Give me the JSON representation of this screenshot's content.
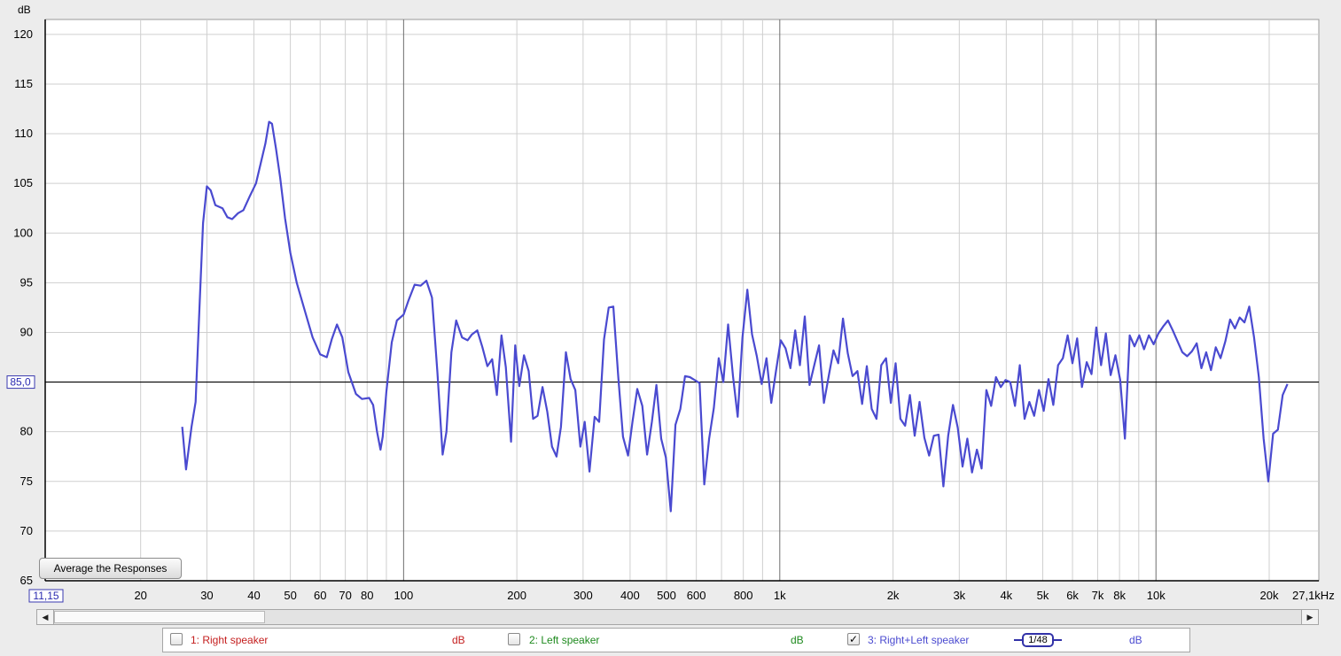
{
  "chart_data": {
    "type": "line",
    "x_scale": "log",
    "y_unit": "dB",
    "x_unit": "kHz",
    "xlim": [
      11.15,
      27100
    ],
    "ylim": [
      65,
      121.5
    ],
    "grid": true,
    "reference_line": 85.0,
    "reference_label": "85,0",
    "x_start_label": "11,15",
    "y_ticks": [
      {
        "value": 120,
        "label": "120"
      },
      {
        "value": 115,
        "label": "115"
      },
      {
        "value": 110,
        "label": "110"
      },
      {
        "value": 105,
        "label": "105"
      },
      {
        "value": 100,
        "label": "100"
      },
      {
        "value": 95,
        "label": "95"
      },
      {
        "value": 90,
        "label": "90"
      },
      {
        "value": 80,
        "label": "80"
      },
      {
        "value": 75,
        "label": "75"
      },
      {
        "value": 70,
        "label": "70"
      },
      {
        "value": 65,
        "label": "65"
      }
    ],
    "x_ticks": [
      {
        "value": 20,
        "label": "20"
      },
      {
        "value": 30,
        "label": "30"
      },
      {
        "value": 40,
        "label": "40"
      },
      {
        "value": 50,
        "label": "50"
      },
      {
        "value": 60,
        "label": "60"
      },
      {
        "value": 70,
        "label": "70"
      },
      {
        "value": 80,
        "label": "80"
      },
      {
        "value": 100,
        "label": "100"
      },
      {
        "value": 200,
        "label": "200"
      },
      {
        "value": 300,
        "label": "300"
      },
      {
        "value": 400,
        "label": "400"
      },
      {
        "value": 500,
        "label": "500"
      },
      {
        "value": 600,
        "label": "600"
      },
      {
        "value": 800,
        "label": "800"
      },
      {
        "value": 1000,
        "label": "1k"
      },
      {
        "value": 2000,
        "label": "2k"
      },
      {
        "value": 3000,
        "label": "3k"
      },
      {
        "value": 4000,
        "label": "4k"
      },
      {
        "value": 5000,
        "label": "5k"
      },
      {
        "value": 6000,
        "label": "6k"
      },
      {
        "value": 7000,
        "label": "7k"
      },
      {
        "value": 8000,
        "label": "8k"
      },
      {
        "value": 10000,
        "label": "10k"
      },
      {
        "value": 20000,
        "label": "20k"
      },
      {
        "value": 27100,
        "label": "27,1kHz"
      }
    ],
    "major_grid_x": [
      100,
      1000,
      10000
    ],
    "minor_grid_x": [
      20,
      30,
      40,
      50,
      60,
      70,
      80,
      90,
      200,
      300,
      400,
      500,
      600,
      700,
      800,
      900,
      2000,
      3000,
      4000,
      5000,
      6000,
      7000,
      8000,
      9000,
      20000
    ],
    "series": [
      {
        "name": "3: Right+Left speaker",
        "color": "#4a4ad0",
        "points": [
          [
            25.8,
            80.5
          ],
          [
            26.4,
            76.2
          ],
          [
            27.3,
            80.5
          ],
          [
            28.0,
            83.0
          ],
          [
            28.7,
            93.0
          ],
          [
            29.3,
            101.0
          ],
          [
            30.0,
            104.7
          ],
          [
            30.7,
            104.3
          ],
          [
            31.6,
            102.8
          ],
          [
            33.0,
            102.5
          ],
          [
            34.0,
            101.6
          ],
          [
            35.0,
            101.4
          ],
          [
            36.3,
            102.0
          ],
          [
            37.5,
            102.3
          ],
          [
            39.0,
            103.7
          ],
          [
            40.5,
            105.0
          ],
          [
            41.7,
            107.0
          ],
          [
            42.9,
            109.0
          ],
          [
            43.9,
            111.2
          ],
          [
            44.7,
            111.0
          ],
          [
            45.8,
            108.5
          ],
          [
            47.0,
            105.5
          ],
          [
            48.4,
            101.5
          ],
          [
            50.0,
            98.0
          ],
          [
            52.0,
            95.0
          ],
          [
            54.8,
            92.0
          ],
          [
            57.3,
            89.5
          ],
          [
            60.0,
            87.8
          ],
          [
            62.5,
            87.5
          ],
          [
            64.4,
            89.3
          ],
          [
            66.5,
            90.8
          ],
          [
            68.7,
            89.5
          ],
          [
            71.3,
            86.0
          ],
          [
            74.7,
            83.8
          ],
          [
            77.5,
            83.3
          ],
          [
            81.0,
            83.4
          ],
          [
            83.0,
            82.7
          ],
          [
            85.0,
            80.0
          ],
          [
            86.8,
            78.2
          ],
          [
            88.0,
            79.5
          ],
          [
            90.0,
            84.0
          ],
          [
            93.0,
            89.0
          ],
          [
            96.0,
            91.2
          ],
          [
            100.0,
            91.8
          ],
          [
            103.0,
            93.2
          ],
          [
            107.0,
            94.8
          ],
          [
            111.0,
            94.7
          ],
          [
            115.0,
            95.2
          ],
          [
            119.0,
            93.5
          ],
          [
            123.0,
            86.0
          ],
          [
            127.0,
            77.7
          ],
          [
            130.0,
            80.0
          ],
          [
            134.0,
            88.0
          ],
          [
            138.0,
            91.2
          ],
          [
            143.0,
            89.5
          ],
          [
            148.0,
            89.2
          ],
          [
            152.0,
            89.8
          ],
          [
            157.0,
            90.2
          ],
          [
            162.0,
            88.5
          ],
          [
            167.0,
            86.6
          ],
          [
            172.0,
            87.3
          ],
          [
            177.0,
            83.7
          ],
          [
            182.0,
            89.7
          ],
          [
            187.0,
            86.5
          ],
          [
            193.0,
            79.0
          ],
          [
            198.0,
            88.7
          ],
          [
            203.0,
            84.6
          ],
          [
            209.0,
            87.7
          ],
          [
            215.0,
            86.1
          ],
          [
            221.0,
            81.3
          ],
          [
            227.0,
            81.6
          ],
          [
            234.0,
            84.5
          ],
          [
            241.0,
            82.0
          ],
          [
            248.0,
            78.5
          ],
          [
            255.0,
            77.5
          ],
          [
            262.0,
            80.5
          ],
          [
            270.0,
            88.0
          ],
          [
            278.0,
            85.3
          ],
          [
            286.0,
            84.2
          ],
          [
            295.0,
            78.5
          ],
          [
            303.0,
            81.0
          ],
          [
            312.0,
            76.0
          ],
          [
            322.0,
            81.5
          ],
          [
            331.0,
            81.0
          ],
          [
            341.0,
            89.3
          ],
          [
            351.0,
            92.5
          ],
          [
            361.0,
            92.6
          ],
          [
            372.0,
            85.6
          ],
          [
            383.0,
            79.5
          ],
          [
            395.0,
            77.6
          ],
          [
            406.0,
            81.0
          ],
          [
            418.0,
            84.3
          ],
          [
            431.0,
            82.6
          ],
          [
            444.0,
            77.7
          ],
          [
            457.0,
            81.0
          ],
          [
            470.0,
            84.7
          ],
          [
            484.0,
            79.3
          ],
          [
            498.0,
            77.4
          ],
          [
            513.0,
            72.0
          ],
          [
            528.0,
            80.7
          ],
          [
            544.0,
            82.3
          ],
          [
            560.0,
            85.6
          ],
          [
            577.0,
            85.5
          ],
          [
            594.0,
            85.2
          ],
          [
            612.0,
            84.9
          ],
          [
            630.0,
            74.7
          ],
          [
            649.0,
            79.3
          ],
          [
            668.0,
            82.4
          ],
          [
            688.0,
            87.4
          ],
          [
            708.0,
            85.0
          ],
          [
            729.0,
            90.8
          ],
          [
            751.0,
            85.6
          ],
          [
            773.0,
            81.5
          ],
          [
            796.0,
            89.5
          ],
          [
            820.0,
            94.3
          ],
          [
            844.0,
            89.8
          ],
          [
            869.0,
            87.6
          ],
          [
            895.0,
            84.8
          ],
          [
            922.0,
            87.4
          ],
          [
            949.0,
            82.9
          ],
          [
            977.0,
            86.1
          ],
          [
            1006.0,
            89.2
          ],
          [
            1036.0,
            88.4
          ],
          [
            1067.0,
            86.4
          ],
          [
            1099.0,
            90.2
          ],
          [
            1131.0,
            86.7
          ],
          [
            1165.0,
            91.6
          ],
          [
            1200.0,
            84.7
          ],
          [
            1235.0,
            86.7
          ],
          [
            1272.0,
            88.7
          ],
          [
            1310.0,
            82.9
          ],
          [
            1349.0,
            85.6
          ],
          [
            1389.0,
            88.2
          ],
          [
            1430.0,
            86.9
          ],
          [
            1472.0,
            91.4
          ],
          [
            1516.0,
            87.9
          ],
          [
            1561.0,
            85.6
          ],
          [
            1608.0,
            86.1
          ],
          [
            1655.0,
            82.8
          ],
          [
            1704.0,
            86.6
          ],
          [
            1755.0,
            82.3
          ],
          [
            1807.0,
            81.3
          ],
          [
            1861.0,
            86.7
          ],
          [
            1916.0,
            87.4
          ],
          [
            1973.0,
            82.9
          ],
          [
            2032.0,
            86.9
          ],
          [
            2092.0,
            81.3
          ],
          [
            2154.0,
            80.6
          ],
          [
            2218.0,
            83.7
          ],
          [
            2284.0,
            79.6
          ],
          [
            2352.0,
            83.0
          ],
          [
            2422.0,
            79.4
          ],
          [
            2494.0,
            77.6
          ],
          [
            2568.0,
            79.6
          ],
          [
            2644.0,
            79.7
          ],
          [
            2722.0,
            74.5
          ],
          [
            2803.0,
            79.6
          ],
          [
            2886.0,
            82.7
          ],
          [
            2972.0,
            80.4
          ],
          [
            3060.0,
            76.5
          ],
          [
            3151.0,
            79.3
          ],
          [
            3244.0,
            75.9
          ],
          [
            3341.0,
            78.2
          ],
          [
            3440.0,
            76.3
          ],
          [
            3542.0,
            84.2
          ],
          [
            3647.0,
            82.6
          ],
          [
            3755.0,
            85.5
          ],
          [
            3867.0,
            84.5
          ],
          [
            3981.0,
            85.2
          ],
          [
            4099.0,
            85.0
          ],
          [
            4221.0,
            82.6
          ],
          [
            4346.0,
            86.7
          ],
          [
            4475.0,
            81.3
          ],
          [
            4608.0,
            83.0
          ],
          [
            4745.0,
            81.6
          ],
          [
            4886.0,
            84.2
          ],
          [
            5031.0,
            82.1
          ],
          [
            5180.0,
            85.3
          ],
          [
            5334.0,
            82.7
          ],
          [
            5492.0,
            86.7
          ],
          [
            5655.0,
            87.4
          ],
          [
            5823.0,
            89.7
          ],
          [
            5996.0,
            86.9
          ],
          [
            6174.0,
            89.4
          ],
          [
            6357.0,
            84.5
          ],
          [
            6546.0,
            87.0
          ],
          [
            6740.0,
            85.8
          ],
          [
            6940.0,
            90.5
          ],
          [
            7146.0,
            86.7
          ],
          [
            7358.0,
            89.9
          ],
          [
            7577.0,
            85.7
          ],
          [
            7801.0,
            87.7
          ],
          [
            8033.0,
            85.2
          ],
          [
            8271.0,
            79.3
          ],
          [
            8517.0,
            89.7
          ],
          [
            8770.0,
            88.6
          ],
          [
            9030.0,
            89.7
          ],
          [
            9298.0,
            88.3
          ],
          [
            9575.0,
            89.7
          ],
          [
            9859.0,
            88.8
          ],
          [
            10152.0,
            89.9
          ],
          [
            10453.0,
            90.6
          ],
          [
            10764.0,
            91.2
          ],
          [
            11083.0,
            90.2
          ],
          [
            11412.0,
            89.1
          ],
          [
            11751.0,
            88.0
          ],
          [
            12100.0,
            87.6
          ],
          [
            12459.0,
            88.1
          ],
          [
            12829.0,
            88.9
          ],
          [
            13210.0,
            86.4
          ],
          [
            13602.0,
            88.0
          ],
          [
            14006.0,
            86.2
          ],
          [
            14422.0,
            88.5
          ],
          [
            14850.0,
            87.4
          ],
          [
            15291.0,
            89.1
          ],
          [
            15745.0,
            91.3
          ],
          [
            16213.0,
            90.4
          ],
          [
            16694.0,
            91.5
          ],
          [
            17190.0,
            91.0
          ],
          [
            17700.0,
            92.6
          ],
          [
            18225.0,
            89.5
          ],
          [
            18766.0,
            85.5
          ],
          [
            19323.0,
            79.3
          ],
          [
            19897.0,
            75.0
          ],
          [
            20487.0,
            79.8
          ],
          [
            21095.0,
            80.2
          ],
          [
            21721.0,
            83.7
          ],
          [
            22365.0,
            84.8
          ]
        ]
      }
    ]
  },
  "controls": {
    "average_button_label": "Average the Responses",
    "scroll_left_glyph": "◀",
    "scroll_right_glyph": "▶"
  },
  "legend": {
    "items": [
      {
        "label": "1: Right speaker",
        "unit": "dB",
        "color": "#c41e1e",
        "checked": false,
        "check_glyph": ""
      },
      {
        "label": "2: Left speaker",
        "unit": "dB",
        "color": "#1e8a1e",
        "checked": false,
        "check_glyph": ""
      },
      {
        "label": "3: Right+Left speaker",
        "unit": "dB",
        "color": "#4a4ad0",
        "checked": true,
        "check_glyph": "✓"
      }
    ],
    "smoothing_label": "1/48"
  }
}
